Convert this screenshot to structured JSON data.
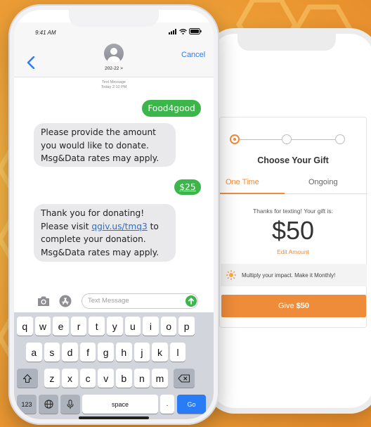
{
  "messages_app": {
    "status": {
      "time": "9:41 AM"
    },
    "contact": {
      "name": "202-22 >"
    },
    "cancel_label": "Cancel",
    "thread_meta": {
      "line1": "Text Message",
      "line2": "Today 2:10 PM"
    },
    "bubbles": {
      "m1": "Food4good",
      "m2": "Please provide the amount you would like to donate. Msg&Data rates may apply.",
      "m3": "$25",
      "m4_before": "Thank you for donating! Please visit ",
      "m4_link": "qgiv.us/tmq3",
      "m4_after": " to complete your donation. Msg&Data rates may apply."
    },
    "input": {
      "placeholder": "Text Message"
    },
    "keyboard": {
      "row1": [
        "q",
        "w",
        "e",
        "r",
        "t",
        "y",
        "u",
        "i",
        "o",
        "p"
      ],
      "row2": [
        "a",
        "s",
        "d",
        "f",
        "g",
        "h",
        "j",
        "k",
        "l"
      ],
      "row3": [
        "z",
        "x",
        "c",
        "v",
        "b",
        "n",
        "m"
      ],
      "num_label": "123",
      "space_label": "space",
      "period_label": ".",
      "go_label": "Go"
    }
  },
  "donation_form": {
    "title": "Choose Your Gift",
    "tabs": {
      "one_time": "One Time",
      "ongoing": "Ongoing"
    },
    "thanks_text": "Thanks for texting! Your gift is:",
    "amount": "$50",
    "edit_label": "Edit Amount",
    "monthly_text": "Multiply your impact. Make it Monthly!",
    "give": {
      "prefix": "Give",
      "amount": "$50"
    }
  },
  "colors": {
    "accent_orange": "#ef8c3a",
    "imessage_green": "#3cb54b",
    "ios_blue": "#2a7cf6",
    "background_gold": "#f0a53a"
  }
}
